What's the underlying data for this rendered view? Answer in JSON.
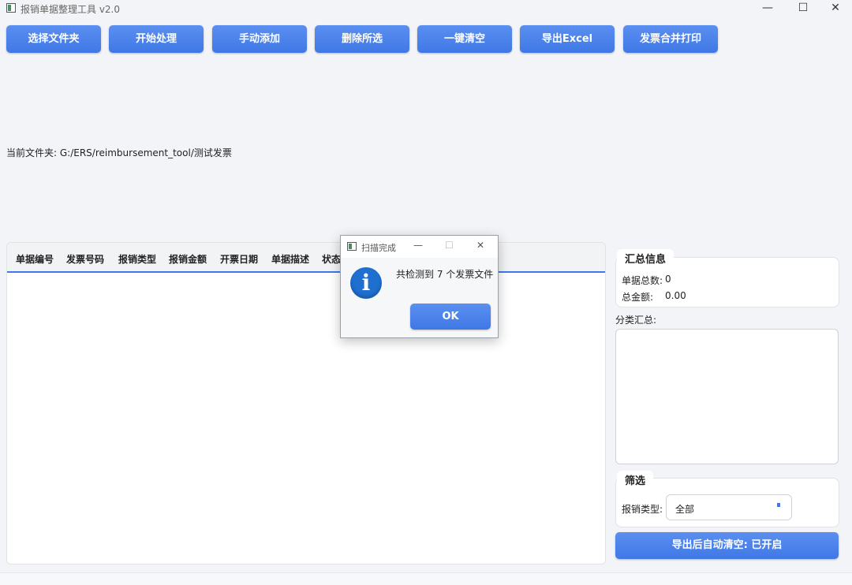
{
  "window": {
    "title": "报销单据整理工具 v2.0",
    "controls": {
      "minimize": "—",
      "maximize": "☐",
      "close": "✕"
    }
  },
  "toolbar": {
    "buttons": [
      {
        "label": "选择文件夹"
      },
      {
        "label": "开始处理"
      },
      {
        "label": "手动添加"
      },
      {
        "label": "删除所选"
      },
      {
        "label": "一键清空"
      },
      {
        "label": "导出Excel"
      },
      {
        "label": "发票合并打印"
      }
    ]
  },
  "folder": {
    "label": "当前文件夹:",
    "path": "G:/ERS/reimbursement_tool/测试发票"
  },
  "table": {
    "columns": [
      "单据编号",
      "发票号码",
      "报销类型",
      "报销金额",
      "开票日期",
      "单据描述",
      "状态"
    ],
    "rows": []
  },
  "summary": {
    "title": "汇总信息",
    "count_label": "单据总数:",
    "count_value": "0",
    "amount_label": "总金额:",
    "amount_value": "0.00"
  },
  "category": {
    "label": "分类汇总:",
    "items": []
  },
  "filter": {
    "title": "筛选",
    "type_label": "报销类型:",
    "type_value": "全部"
  },
  "bottom_button": {
    "label": "导出后自动清空: 已开启"
  },
  "dialog": {
    "title": "扫描完成",
    "message": "共检测到 7 个发票文件",
    "ok_label": "OK",
    "icon_glyph": "i",
    "controls": {
      "minimize": "—",
      "maximize": "☐",
      "close": "✕"
    }
  },
  "colors": {
    "accent": "#3f78e6",
    "info_icon": "#1e6fd0",
    "background": "#f3f4f7"
  }
}
